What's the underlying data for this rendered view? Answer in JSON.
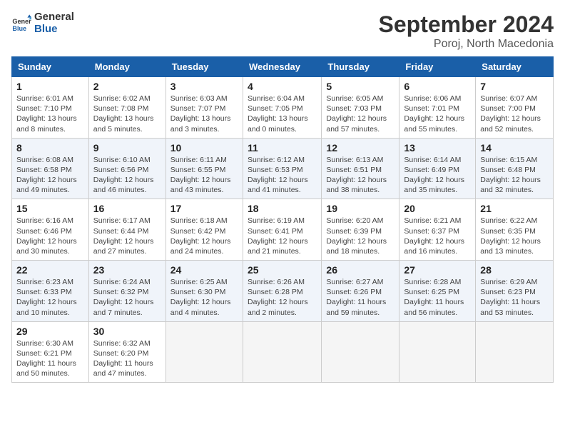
{
  "logo": {
    "text_general": "General",
    "text_blue": "Blue"
  },
  "header": {
    "month": "September 2024",
    "location": "Poroj, North Macedonia"
  },
  "days_of_week": [
    "Sunday",
    "Monday",
    "Tuesday",
    "Wednesday",
    "Thursday",
    "Friday",
    "Saturday"
  ],
  "weeks": [
    [
      {
        "day": "1",
        "sunrise": "6:01 AM",
        "sunset": "7:10 PM",
        "daylight": "13 hours and 8 minutes."
      },
      {
        "day": "2",
        "sunrise": "6:02 AM",
        "sunset": "7:08 PM",
        "daylight": "13 hours and 5 minutes."
      },
      {
        "day": "3",
        "sunrise": "6:03 AM",
        "sunset": "7:07 PM",
        "daylight": "13 hours and 3 minutes."
      },
      {
        "day": "4",
        "sunrise": "6:04 AM",
        "sunset": "7:05 PM",
        "daylight": "13 hours and 0 minutes."
      },
      {
        "day": "5",
        "sunrise": "6:05 AM",
        "sunset": "7:03 PM",
        "daylight": "12 hours and 57 minutes."
      },
      {
        "day": "6",
        "sunrise": "6:06 AM",
        "sunset": "7:01 PM",
        "daylight": "12 hours and 55 minutes."
      },
      {
        "day": "7",
        "sunrise": "6:07 AM",
        "sunset": "7:00 PM",
        "daylight": "12 hours and 52 minutes."
      }
    ],
    [
      {
        "day": "8",
        "sunrise": "6:08 AM",
        "sunset": "6:58 PM",
        "daylight": "12 hours and 49 minutes."
      },
      {
        "day": "9",
        "sunrise": "6:10 AM",
        "sunset": "6:56 PM",
        "daylight": "12 hours and 46 minutes."
      },
      {
        "day": "10",
        "sunrise": "6:11 AM",
        "sunset": "6:55 PM",
        "daylight": "12 hours and 43 minutes."
      },
      {
        "day": "11",
        "sunrise": "6:12 AM",
        "sunset": "6:53 PM",
        "daylight": "12 hours and 41 minutes."
      },
      {
        "day": "12",
        "sunrise": "6:13 AM",
        "sunset": "6:51 PM",
        "daylight": "12 hours and 38 minutes."
      },
      {
        "day": "13",
        "sunrise": "6:14 AM",
        "sunset": "6:49 PM",
        "daylight": "12 hours and 35 minutes."
      },
      {
        "day": "14",
        "sunrise": "6:15 AM",
        "sunset": "6:48 PM",
        "daylight": "12 hours and 32 minutes."
      }
    ],
    [
      {
        "day": "15",
        "sunrise": "6:16 AM",
        "sunset": "6:46 PM",
        "daylight": "12 hours and 30 minutes."
      },
      {
        "day": "16",
        "sunrise": "6:17 AM",
        "sunset": "6:44 PM",
        "daylight": "12 hours and 27 minutes."
      },
      {
        "day": "17",
        "sunrise": "6:18 AM",
        "sunset": "6:42 PM",
        "daylight": "12 hours and 24 minutes."
      },
      {
        "day": "18",
        "sunrise": "6:19 AM",
        "sunset": "6:41 PM",
        "daylight": "12 hours and 21 minutes."
      },
      {
        "day": "19",
        "sunrise": "6:20 AM",
        "sunset": "6:39 PM",
        "daylight": "12 hours and 18 minutes."
      },
      {
        "day": "20",
        "sunrise": "6:21 AM",
        "sunset": "6:37 PM",
        "daylight": "12 hours and 16 minutes."
      },
      {
        "day": "21",
        "sunrise": "6:22 AM",
        "sunset": "6:35 PM",
        "daylight": "12 hours and 13 minutes."
      }
    ],
    [
      {
        "day": "22",
        "sunrise": "6:23 AM",
        "sunset": "6:33 PM",
        "daylight": "12 hours and 10 minutes."
      },
      {
        "day": "23",
        "sunrise": "6:24 AM",
        "sunset": "6:32 PM",
        "daylight": "12 hours and 7 minutes."
      },
      {
        "day": "24",
        "sunrise": "6:25 AM",
        "sunset": "6:30 PM",
        "daylight": "12 hours and 4 minutes."
      },
      {
        "day": "25",
        "sunrise": "6:26 AM",
        "sunset": "6:28 PM",
        "daylight": "12 hours and 2 minutes."
      },
      {
        "day": "26",
        "sunrise": "6:27 AM",
        "sunset": "6:26 PM",
        "daylight": "11 hours and 59 minutes."
      },
      {
        "day": "27",
        "sunrise": "6:28 AM",
        "sunset": "6:25 PM",
        "daylight": "11 hours and 56 minutes."
      },
      {
        "day": "28",
        "sunrise": "6:29 AM",
        "sunset": "6:23 PM",
        "daylight": "11 hours and 53 minutes."
      }
    ],
    [
      {
        "day": "29",
        "sunrise": "6:30 AM",
        "sunset": "6:21 PM",
        "daylight": "11 hours and 50 minutes."
      },
      {
        "day": "30",
        "sunrise": "6:32 AM",
        "sunset": "6:20 PM",
        "daylight": "11 hours and 47 minutes."
      },
      null,
      null,
      null,
      null,
      null
    ]
  ],
  "labels": {
    "sunrise": "Sunrise:",
    "sunset": "Sunset:",
    "daylight": "Daylight:"
  }
}
